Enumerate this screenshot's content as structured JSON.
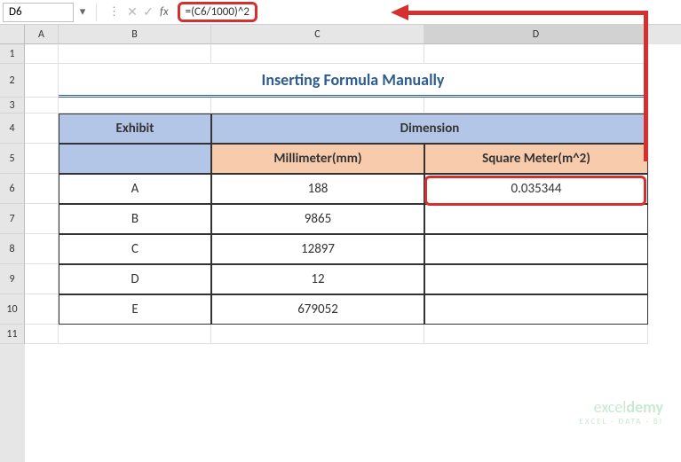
{
  "nameBox": "D6",
  "formula": "=(C6/1000)^2",
  "fxLabel": "fx",
  "columns": [
    "A",
    "B",
    "C",
    "D"
  ],
  "rows": [
    "1",
    "2",
    "3",
    "4",
    "5",
    "6",
    "7",
    "8",
    "9",
    "10",
    "11"
  ],
  "title": "Inserting Formula Manually",
  "headers": {
    "exhibit": "Exhibit",
    "dimension": "Dimension",
    "mm": "Millimeter(mm)",
    "m2": "Square Meter(m^2)"
  },
  "data": [
    {
      "exhibit": "A",
      "mm": "188",
      "m2": "0.035344"
    },
    {
      "exhibit": "B",
      "mm": "9865",
      "m2": ""
    },
    {
      "exhibit": "C",
      "mm": "12897",
      "m2": ""
    },
    {
      "exhibit": "D",
      "mm": "12",
      "m2": ""
    },
    {
      "exhibit": "E",
      "mm": "679052",
      "m2": ""
    }
  ],
  "watermark": {
    "brand1": "excel",
    "brand2": "demy",
    "tagline": "EXCEL · DATA · BI"
  }
}
